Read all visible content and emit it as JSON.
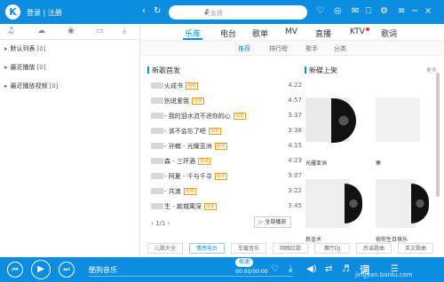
{
  "topbar": {
    "logo": "K",
    "login": "登录 | 注册",
    "search_placeholder": "火女孩"
  },
  "left": {
    "rows": [
      {
        "label": "默认列表",
        "count": "[0]"
      },
      {
        "label": "最近播放",
        "count": "[0]"
      },
      {
        "label": "最近播放视频",
        "count": "[0]"
      }
    ]
  },
  "main_tabs": [
    "乐库",
    "电台",
    "歌单",
    "MV",
    "直播",
    "KTV",
    "歌词"
  ],
  "sub_tabs": [
    "推荐",
    "排行榜",
    "歌手",
    "分类"
  ],
  "new_songs": {
    "title": "新歌首发",
    "items": [
      {
        "name": "火成书",
        "tag": "独家",
        "dur": "4:22"
      },
      {
        "name": "别说爱我",
        "tag": "独家",
        "dur": "4:57"
      },
      {
        "name": "- 我的泪水流不进你的心",
        "tag": "独家",
        "dur": "3:37"
      },
      {
        "name": "- 该不会忘了吧",
        "tag": "独家",
        "dur": "3:38"
      },
      {
        "name": "- 孙楠 - 光耀亚洲",
        "tag": "独家",
        "dur": "4:15"
      },
      {
        "name": "森 - 三环酒",
        "tag": "独家",
        "dur": "4:23"
      },
      {
        "name": "- 阿夏 - 千与千寻",
        "tag": "独家",
        "dur": "3:07"
      },
      {
        "name": "- 共渡",
        "tag": "独家",
        "dur": "3:22"
      },
      {
        "name": "生 - 款城寓深",
        "tag": "独家",
        "dur": "3:45"
      }
    ],
    "pager": "1/1",
    "play_all": "全部播放"
  },
  "new_albums": {
    "title": "新碟上架",
    "more": "更多",
    "albums": [
      {
        "name": "光耀亚洲"
      },
      {
        "name": "寒"
      },
      {
        "name": "炼金术"
      },
      {
        "name": "祝你生日快乐"
      }
    ]
  },
  "categories": [
    "儿歌大全",
    "情感电台",
    "车载音乐",
    "网络红歌",
    "舞厅DJ",
    "民谣歌曲",
    "英文歌曲"
  ],
  "player": {
    "title": "酷狗音乐",
    "time": "00:00/00:00",
    "pill": "极速",
    "lyrics": "词",
    "watermark": "jingyan.baidu.com"
  },
  "colors": {
    "accent": "#0c8ddf",
    "tag": "#f39c12",
    "badge": "#e53935"
  }
}
